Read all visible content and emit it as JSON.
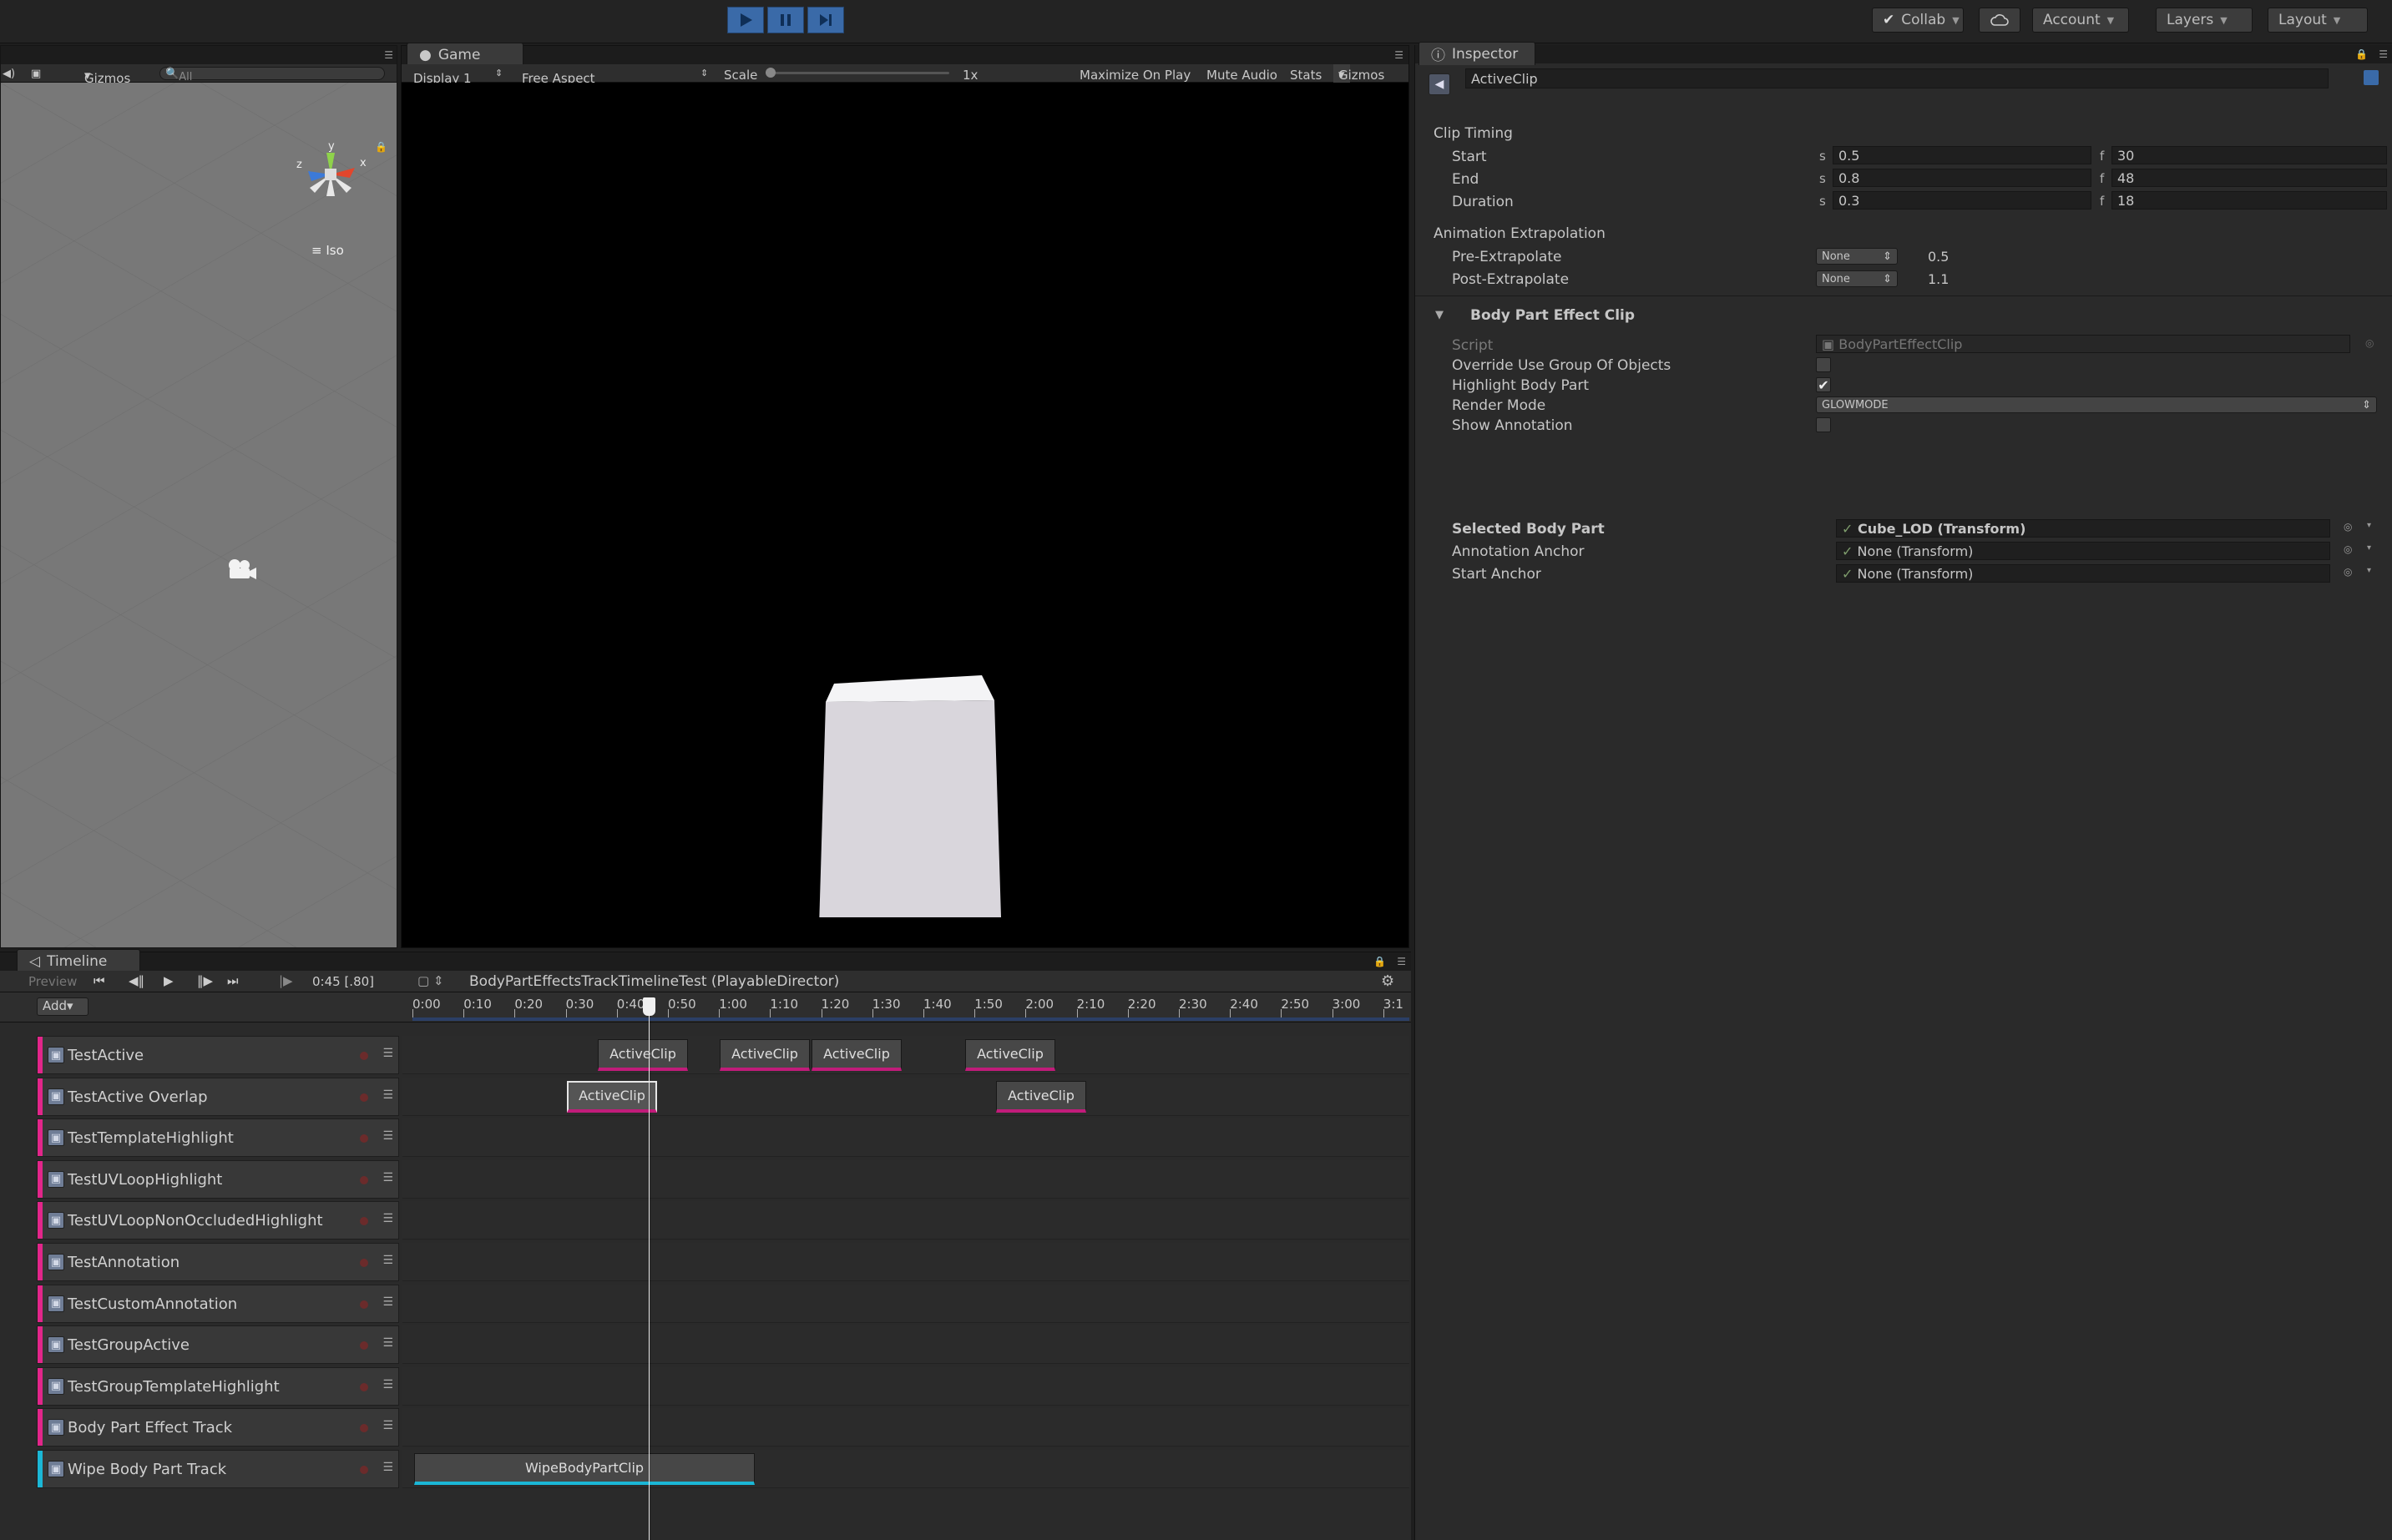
{
  "toolbar": {
    "collab_label": "Collab",
    "account_label": "Account",
    "layers_label": "Layers",
    "layout_label": "Layout",
    "play_icon": "play-icon",
    "pause_icon": "pause-icon",
    "step_icon": "step-icon"
  },
  "scene": {
    "gizmos_label": "Gizmos",
    "search_placeholder": "All",
    "projection_label": "Iso",
    "axis_y": "y",
    "axis_x": "x",
    "axis_z": "z"
  },
  "game": {
    "tab_label": "Game",
    "display_label": "Display 1",
    "aspect_label": "Free Aspect",
    "scale_label": "Scale",
    "scale_value": "1x",
    "maximize_label": "Maximize On Play",
    "mute_label": "Mute Audio",
    "stats_label": "Stats",
    "gizmos_label": "Gizmos"
  },
  "inspector": {
    "tab_label": "Inspector",
    "object_name": "ActiveClip",
    "clip_timing_header": "Clip Timing",
    "start_label": "Start",
    "start_s": "0.5",
    "start_f": "30",
    "end_label": "End",
    "end_s": "0.8",
    "end_f": "48",
    "duration_label": "Duration",
    "duration_s": "0.3",
    "duration_f": "18",
    "s_prefix": "s",
    "f_prefix": "f",
    "extrapolation_header": "Animation Extrapolation",
    "pre_label": "Pre-Extrapolate",
    "pre_mode": "None",
    "pre_value": "0.5",
    "post_label": "Post-Extrapolate",
    "post_mode": "None",
    "post_value": "1.1",
    "component_header": "Body Part Effect Clip",
    "script_label": "Script",
    "script_value": "BodyPartEffectClip",
    "override_label": "Override Use Group Of Objects",
    "override_checked": false,
    "highlight_label": "Highlight Body Part",
    "highlight_checked": true,
    "render_mode_label": "Render Mode",
    "render_mode_value": "GLOWMODE",
    "show_annotation_label": "Show Annotation",
    "show_annotation_checked": false,
    "selected_body_part_label": "Selected Body Part",
    "selected_body_part_value": "Cube_LOD (Transform)",
    "annotation_anchor_label": "Annotation Anchor",
    "annotation_anchor_value": "None (Transform)",
    "start_anchor_label": "Start Anchor",
    "start_anchor_value": "None (Transform)"
  },
  "timeline": {
    "tab_label": "Timeline",
    "preview_label": "Preview",
    "time_display": "0:45 [.80]",
    "director_label": "BodyPartEffectsTrackTimelineTest (PlayableDirector)",
    "add_label": "Add",
    "ruler": [
      "0:00",
      "0:10",
      "0:20",
      "0:30",
      "0:40",
      "0:50",
      "1:00",
      "1:10",
      "1:20",
      "1:30",
      "1:40",
      "1:50",
      "2:00",
      "2:10",
      "2:20",
      "2:30",
      "2:40",
      "2:50",
      "3:00",
      "3:1"
    ],
    "tracks": [
      {
        "name": "TestActive",
        "color": "#e2268a"
      },
      {
        "name": "TestActive Overlap",
        "color": "#e2268a"
      },
      {
        "name": "TestTemplateHighlight",
        "color": "#e2268a"
      },
      {
        "name": "TestUVLoopHighlight",
        "color": "#e2268a"
      },
      {
        "name": "TestUVLoopNonOccludedHighlight",
        "color": "#e2268a"
      },
      {
        "name": "TestAnnotation",
        "color": "#e2268a"
      },
      {
        "name": "TestCustomAnnotation",
        "color": "#e2268a"
      },
      {
        "name": "TestGroupActive",
        "color": "#e2268a"
      },
      {
        "name": "TestGroupTemplateHighlight",
        "color": "#e2268a"
      },
      {
        "name": "Body Part Effect Track",
        "color": "#e2268a"
      },
      {
        "name": "Wipe Body Part Track",
        "color": "#1bb7d6"
      }
    ],
    "clips": {
      "active_label": "ActiveClip",
      "wipe_label": "WipeBodyPartClip"
    }
  }
}
